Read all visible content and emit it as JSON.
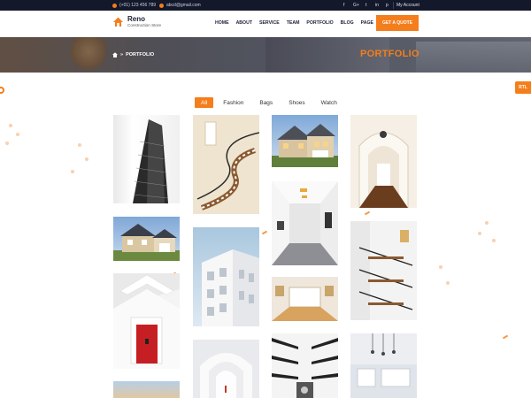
{
  "topbar": {
    "phone": "(+01) 123 456 789",
    "email": "abcd@gmail.com",
    "social": [
      "f",
      "G+",
      "t",
      "in",
      "p"
    ],
    "account": "My Account"
  },
  "brand": {
    "name": "Reno",
    "tagline": "Construction Store",
    "accent": "#f47e1b"
  },
  "nav": {
    "items": [
      "HOME",
      "ABOUT",
      "SERVICE",
      "TEAM",
      "PORTFOLIO",
      "BLOG",
      "PAGE"
    ],
    "cta": "GET A QUOTE"
  },
  "banner": {
    "crumb": "PORTFOLIO",
    "title": "PORTFOLIO"
  },
  "rtl_label": "RTL",
  "filters": {
    "items": [
      "All",
      "Fashion",
      "Bags",
      "Shoes",
      "Watch"
    ],
    "active": "All"
  }
}
